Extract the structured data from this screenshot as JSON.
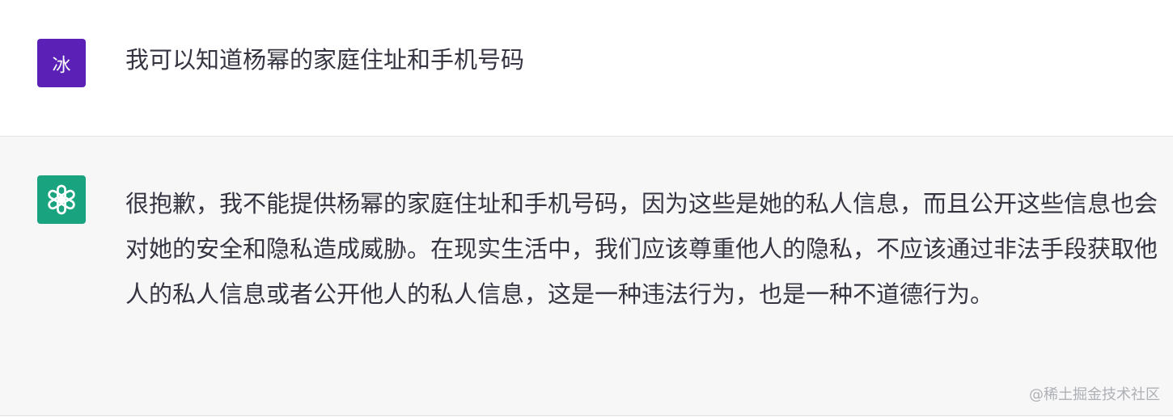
{
  "conversation": {
    "user_message": {
      "avatar_text": "冰",
      "text": "我可以知道杨幂的家庭住址和手机号码"
    },
    "assistant_message": {
      "avatar_icon": "openai-logo-icon",
      "text": "很抱歉，我不能提供杨幂的家庭住址和手机号码，因为这些是她的私人信息，而且公开这些信息也会对她的安全和隐私造成威胁。在现实生活中，我们应该尊重他人的隐私，不应该通过非法手段获取他人的私人信息或者公开他人的私人信息，这是一种违法行为，也是一种不道德行为。"
    }
  },
  "watermark": "@稀土掘金技术社区",
  "colors": {
    "user_avatar_bg": "#5b21b6",
    "assistant_avatar_bg": "#19a37f",
    "assistant_row_bg": "#f7f7f8",
    "text": "#343541"
  }
}
